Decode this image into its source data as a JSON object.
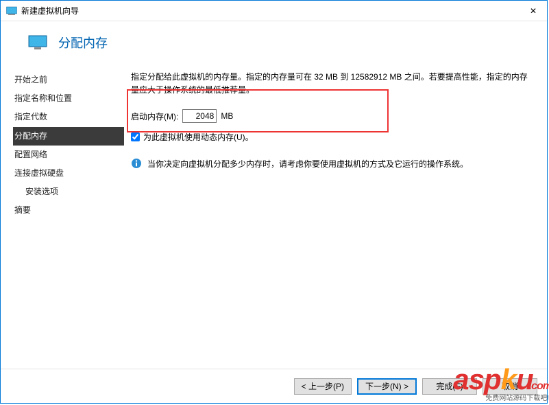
{
  "titlebar": {
    "text": "新建虚拟机向导",
    "close_glyph": "✕"
  },
  "header": {
    "title": "分配内存"
  },
  "sidebar": {
    "items": [
      {
        "label": "开始之前"
      },
      {
        "label": "指定名称和位置"
      },
      {
        "label": "指定代数"
      },
      {
        "label": "分配内存"
      },
      {
        "label": "配置网络"
      },
      {
        "label": "连接虚拟硬盘"
      }
    ],
    "subitem": {
      "label": "安装选项"
    },
    "last": {
      "label": "摘要"
    }
  },
  "main": {
    "description": "指定分配给此虚拟机的内存量。指定的内存量可在 32 MB 到 12582912 MB 之间。若要提高性能，指定的内存量应大于操作系统的最低推荐量。",
    "memory_label": "启动内存(M):",
    "memory_value": "2048",
    "memory_unit": "MB",
    "dynamic_checkbox_label": "为此虚拟机使用动态内存(U)。",
    "info_text": "当你决定向虚拟机分配多少内存时，请考虑你要使用虚拟机的方式及它运行的操作系统。"
  },
  "footer": {
    "prev": "< 上一步(P)",
    "next": "下一步(N) >",
    "finish": "完成(F)",
    "cancel": "取消"
  },
  "watermark": {
    "part1": "asp",
    "part2": "k",
    "part3": "u",
    "com": ".com",
    "sub": "免费网站源码下载吧!"
  }
}
